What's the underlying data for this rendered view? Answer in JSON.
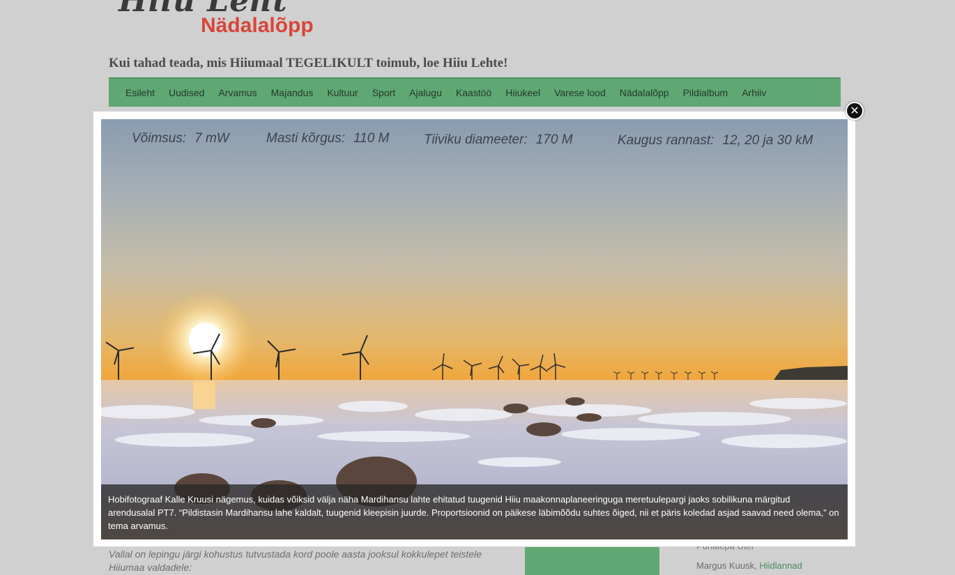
{
  "header": {
    "logo_script": "Hiiu Leht",
    "logo_sub": "Nädalalõpp",
    "tagline": "Kui tahad teada, mis Hiiumaal TEGELIKULT toimub, loe Hiiu Lehte!"
  },
  "nav": {
    "items": [
      "Esileht",
      "Uudised",
      "Arvamus",
      "Majandus",
      "Kultuur",
      "Sport",
      "Ajalugu",
      "Kaastöö",
      "Hiiukeel",
      "Varese lood",
      "Nädalalõpp",
      "Pildialbum",
      "Arhiiv"
    ]
  },
  "lightbox": {
    "metrics": [
      {
        "label": "Võimsus:",
        "value": "7 mW"
      },
      {
        "label": "Masti kõrgus:",
        "value": "110 M"
      },
      {
        "label": "Tiiviku diameeter:",
        "value": "170 M"
      },
      {
        "label": "Kaugus rannast:",
        "value": "12, 20 ja 30 kM"
      }
    ],
    "caption": "Hobifotograaf Kalle Kruusi nägemus, kuidas võiksid välja näha Mardihansu lahte ehitatud tuugenid Hiiu maakonnaplaneeringuga meretuulepargi jaoks sobilikuna märgitud arendusalal PT7. “Pildistasin Mardihansu lahe kaldalt, tuugenid kleepisin juurde. Proportsioonid on päikese läbimõõdu suhtes õiged, nii et päris koledad asjad saavad need olema,” on tema arvamus.",
    "close_icon": "close-icon"
  },
  "background": {
    "article_text": "Vallal on lepingu järgi kohustus tutvustada kord poole aasta jooksul kokkulepet teistele Hiiumaa valdadele:",
    "side_item_1": "Puhalepa Ütel",
    "side_item_2_author": "Margus Kuusk,",
    "side_item_2_link": "Hiidlannad"
  },
  "colors": {
    "nav_green": "#5fa874",
    "logo_red": "#d9453a"
  }
}
